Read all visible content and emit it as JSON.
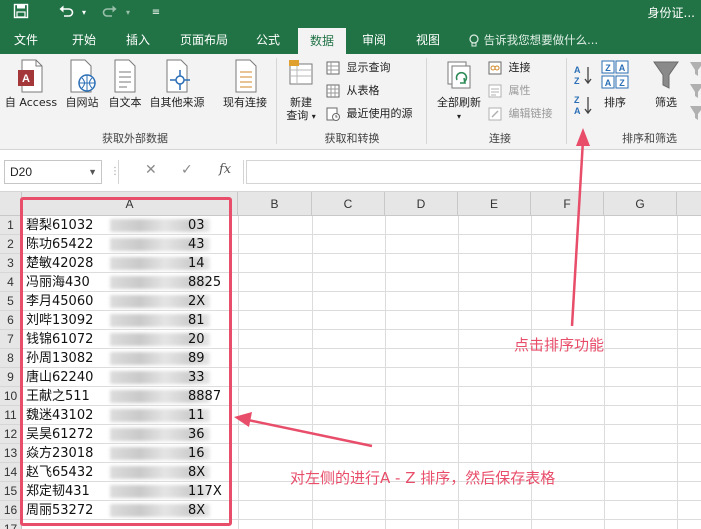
{
  "titlebar": {
    "title": "身份证...",
    "quick_access": [
      "save-icon",
      "undo-icon",
      "redo-icon",
      "customize-icon"
    ]
  },
  "tabs": [
    {
      "label": "文件"
    },
    {
      "label": "开始"
    },
    {
      "label": "插入"
    },
    {
      "label": "页面布局"
    },
    {
      "label": "公式"
    },
    {
      "label": "数据",
      "active": true
    },
    {
      "label": "审阅"
    },
    {
      "label": "视图"
    }
  ],
  "tell_me": "告诉我您想要做什么...",
  "ribbon": {
    "external": {
      "access": "自 Access",
      "web": "自网站",
      "text": "自文本",
      "other": "自其他来源",
      "existing": "现有连接",
      "label": "获取外部数据"
    },
    "transform": {
      "new_query_line1": "新建",
      "new_query_line2": "查询",
      "show_query": "显示查询",
      "from_table": "从表格",
      "recent_sources": "最近使用的源",
      "label": "获取和转换"
    },
    "connections": {
      "refresh_all": "全部刷新",
      "connections": "连接",
      "properties": "属性",
      "edit_links": "编辑链接",
      "label": "连接"
    },
    "sort_filter": {
      "sort": "排序",
      "filter": "筛选",
      "label": "排序和筛选"
    }
  },
  "formula_bar": {
    "name_box": "D20",
    "formula": ""
  },
  "grid": {
    "columns": [
      "A",
      "B",
      "C",
      "D",
      "E",
      "F",
      "G"
    ],
    "rows": [
      "1",
      "2",
      "3",
      "4",
      "5",
      "6",
      "7",
      "8",
      "9",
      "10",
      "11",
      "12",
      "13",
      "14",
      "15",
      "16",
      "17"
    ],
    "cells": [
      {
        "name": "碧梨61032",
        "tail": "03"
      },
      {
        "name": "陈功65422",
        "tail": "43"
      },
      {
        "name": "楚敏42028",
        "tail": "14"
      },
      {
        "name": "冯丽海430",
        "tail": "8825"
      },
      {
        "name": "李月45060",
        "tail": "2X"
      },
      {
        "name": "刘哔13092",
        "tail": "81"
      },
      {
        "name": "钱锦61072",
        "tail": "20"
      },
      {
        "name": "孙周13082",
        "tail": "89"
      },
      {
        "name": "唐山62240",
        "tail": "33"
      },
      {
        "name": "王献之511",
        "tail": "8887"
      },
      {
        "name": "魏迷43102",
        "tail": "11"
      },
      {
        "name": "吴昊61272",
        "tail": "36"
      },
      {
        "name": "焱方23018",
        "tail": "16"
      },
      {
        "name": "赵飞65432",
        "tail": "8X"
      },
      {
        "name": "郑定韧431",
        "tail": "117X"
      },
      {
        "name": "周丽53272",
        "tail": "8X"
      }
    ]
  },
  "annotations": {
    "sort_tip": "点击排序功能",
    "left_tip": "对左侧的进行A - Z 排序，然后保存表格"
  },
  "colors": {
    "excel_green": "#217346",
    "annotation_red": "#e84d6a"
  }
}
